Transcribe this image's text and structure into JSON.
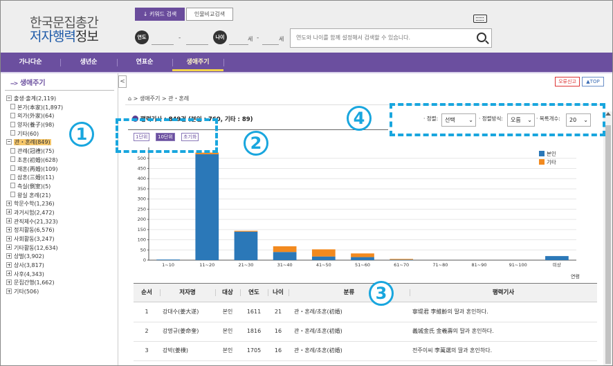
{
  "header": {
    "logo_line1": "한국문집총간",
    "logo_line2_blue": "저자행력",
    "logo_line2_rest": "정보",
    "tab_keyword": "↓  키워드 검색",
    "tab_person": "인물비교검색",
    "year_label": "연도",
    "age_label": "나이",
    "range_dash": "-",
    "age_unit1": "세",
    "age_dash": "-",
    "age_unit2": "세",
    "search_placeholder": "연도와 나이를 함께 설정해서 검색할 수 있습니다."
  },
  "nav": {
    "items": [
      "가나다순",
      "생년순",
      "연표순",
      "생애주기"
    ],
    "active": "생애주기"
  },
  "sidebar": {
    "title": "생애주기",
    "arrow": "-->",
    "tree": [
      {
        "label": "출생·출계(2,119)",
        "type": "minus"
      },
      {
        "label": "본가(本家)(1,897)",
        "type": "doc",
        "child": true
      },
      {
        "label": "외가(外家)(64)",
        "type": "doc",
        "child": true
      },
      {
        "label": "양자(養子)(98)",
        "type": "doc",
        "child": true
      },
      {
        "label": "기타(60)",
        "type": "doc",
        "child": true
      },
      {
        "label": "관・혼례(849)",
        "type": "minus",
        "selected": true
      },
      {
        "label": "관례(冠禮)(75)",
        "type": "doc",
        "child": true
      },
      {
        "label": "초혼(初婚)(628)",
        "type": "doc",
        "child": true
      },
      {
        "label": "재혼(再婚)(109)",
        "type": "doc",
        "child": true
      },
      {
        "label": "삼혼(三婚)(11)",
        "type": "doc",
        "child": true
      },
      {
        "label": "측실(側室)(5)",
        "type": "doc",
        "child": true
      },
      {
        "label": "왕실 혼례(21)",
        "type": "doc",
        "child": true
      },
      {
        "label": "학문수학(1,236)",
        "type": "plus"
      },
      {
        "label": "과거시험(2,472)",
        "type": "plus"
      },
      {
        "label": "관직제수(21,323)",
        "type": "plus"
      },
      {
        "label": "정치활동(6,576)",
        "type": "plus"
      },
      {
        "label": "사회활동(3,247)",
        "type": "plus"
      },
      {
        "label": "기타활동(12,634)",
        "type": "plus"
      },
      {
        "label": "상벌(3,902)",
        "type": "plus"
      },
      {
        "label": "상사(3,817)",
        "type": "plus"
      },
      {
        "label": "사후(4,343)",
        "type": "plus"
      },
      {
        "label": "문집간행(1,662)",
        "type": "plus"
      },
      {
        "label": "기타(506)",
        "type": "plus"
      }
    ]
  },
  "content": {
    "btn_error": "오류신고",
    "btn_top": "▲TOP",
    "breadcrumb": "⌂ > 생애주기 > 관・혼례",
    "section_title": "행력기사 : 849건 (본인 : 760, 기타 : 89)",
    "unit_buttons": [
      "1단위",
      "10단위",
      "초기화"
    ],
    "sort_label": "· 정렬:",
    "sort_value": "선택",
    "order_label": "· 정렬방식:",
    "order_value": "오름",
    "count_label": "· 목록개수:",
    "count_value": "20",
    "chart_xlabel": "연령"
  },
  "chart_data": {
    "type": "bar",
    "stacked": true,
    "categories": [
      "1~10",
      "11~20",
      "21~30",
      "31~40",
      "41~50",
      "51~60",
      "61~70",
      "71~80",
      "81~90",
      "91~100",
      "미상"
    ],
    "series": [
      {
        "name": "본인",
        "color": "#2b78b8",
        "values": [
          3,
          520,
          140,
          40,
          18,
          15,
          2,
          0,
          0,
          0,
          20
        ]
      },
      {
        "name": "기타",
        "color": "#f28a1f",
        "values": [
          0,
          8,
          4,
          28,
          35,
          18,
          4,
          0,
          0,
          0,
          0
        ]
      }
    ],
    "yticks": [
      0,
      50,
      100,
      150,
      200,
      250,
      300,
      350,
      400,
      450,
      500
    ],
    "ylim": [
      0,
      540
    ],
    "xlabel": "연령",
    "legend_position": "top-right"
  },
  "table": {
    "headers": [
      "순서",
      "저자명",
      "대상",
      "연도",
      "나이",
      "분류",
      "행력기사"
    ],
    "rows": [
      [
        "1",
        "강대수(姜大遂)",
        "본인",
        "1611",
        "21",
        "관・혼례/초혼(初婚)",
        "寧堤君 李維齡의 딸과 혼인하다."
      ],
      [
        "2",
        "강명규(姜命奎)",
        "본인",
        "1816",
        "16",
        "관・혼례/초혼(初婚)",
        "義城金氏 金羲壽의 딸과 혼인하다."
      ],
      [
        "3",
        "강박(姜樸)",
        "본인",
        "1705",
        "16",
        "관・혼례/초혼(初婚)",
        "전주이씨 李萬選의 딸과 혼인하다."
      ]
    ]
  },
  "annotations": [
    "1",
    "2",
    "3",
    "4"
  ]
}
